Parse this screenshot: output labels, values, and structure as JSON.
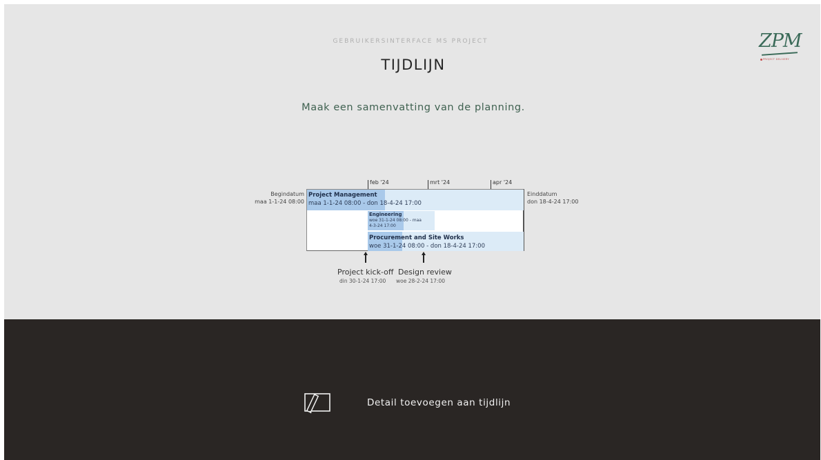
{
  "slide": {
    "subtitle": "GEBRUIKERSINTERFACE MS PROJECT",
    "title": "TIJDLIJN",
    "tagline": "Maak een samenvatting  van de planning."
  },
  "logo": {
    "mark": "ZPM",
    "sub": "PROJECT DELIVERY"
  },
  "timeline": {
    "ticks": [
      "feb '24",
      "mrt '24",
      "apr '24"
    ],
    "start": {
      "label": "Begindatum",
      "date": "maa 1-1-24 08:00"
    },
    "end": {
      "label": "Einddatum",
      "date": "don 18-4-24 17:00"
    },
    "tasks": [
      {
        "name": "Project Management",
        "dates": "maa 1-1-24 08:00 - don 18-4-24 17:00",
        "progress": 0.36
      },
      {
        "name": "Engineering",
        "dates_line1": "woe 31-1-24 08:00 - maa",
        "dates_line2": "4-3-24 17:00",
        "progress": 0.54
      },
      {
        "name": "Procurement and Site Works",
        "dates": "woe 31-1-24 08:00 - don 18-4-24 17:00",
        "progress": 0.22
      }
    ],
    "milestones": [
      {
        "name": "Project kick-off",
        "date": "din 30-1-24 17:00"
      },
      {
        "name": "Design review",
        "date": "woe 28-2-24 17:00"
      }
    ]
  },
  "command": {
    "icon": "pencil-edit-icon",
    "label": "Detail toevoegen aan tijdlijn"
  },
  "colors": {
    "top_background": "#e6e6e6",
    "bottom_background": "#2a2624",
    "bar_fill": "#dcebf7",
    "bar_progress": "#a9c9ea",
    "tagline": "#3f6150",
    "brand": "#3a6a58"
  }
}
